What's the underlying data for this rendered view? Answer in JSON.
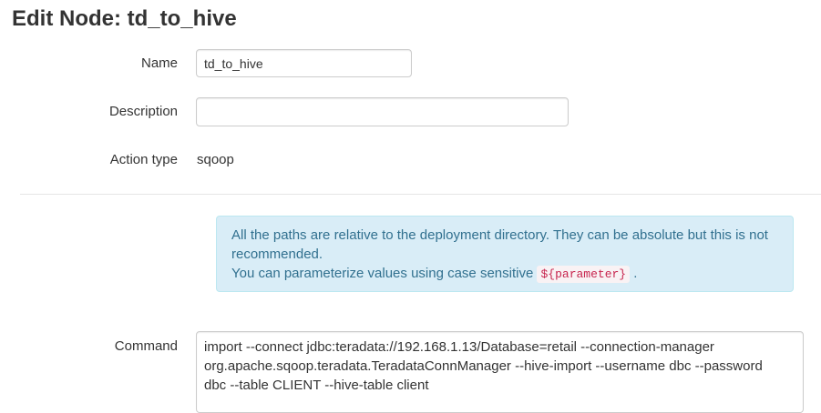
{
  "page": {
    "title": "Edit Node: td_to_hive"
  },
  "form": {
    "name": {
      "label": "Name",
      "value": "td_to_hive"
    },
    "description": {
      "label": "Description",
      "value": ""
    },
    "action_type": {
      "label": "Action type",
      "value": "sqoop"
    },
    "info": {
      "line1": "All the paths are relative to the deployment directory. They can be absolute but this is not recommended.",
      "line2_prefix": "You can parameterize values using case sensitive",
      "param_code": "${parameter}",
      "line2_suffix": "."
    },
    "command": {
      "label": "Command",
      "value": "import --connect jdbc:teradata://192.168.1.13/Database=retail --connection-manager\norg.apache.sqoop.teradata.TeradataConnManager --hive-import --username dbc --password\ndbc --table CLIENT --hive-table client"
    }
  },
  "colors": {
    "info_background": "#d9edf7",
    "info_border": "#bce8f1",
    "info_text": "#31708f",
    "code_text": "#c7254e",
    "code_background": "#f9f2f4"
  }
}
